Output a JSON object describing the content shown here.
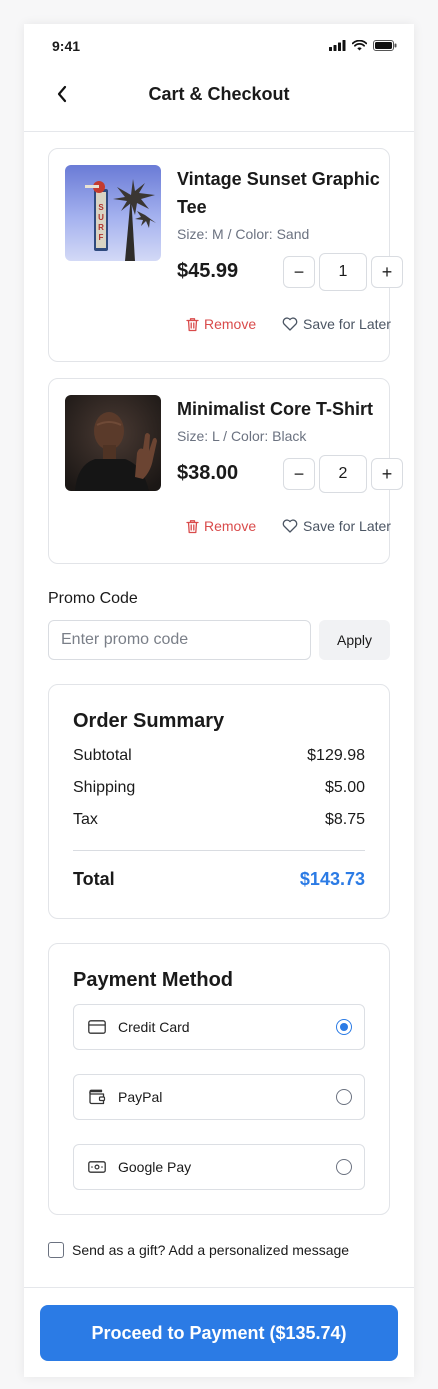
{
  "status_bar": {
    "time": "9:41",
    "icons": [
      "signal-icon",
      "wifi-icon",
      "battery-icon"
    ]
  },
  "header": {
    "title": "Cart & Checkout",
    "back_icon": "chevron-left-icon"
  },
  "cart": {
    "items": [
      {
        "name": "Vintage Sunset Graphic Tee",
        "meta": "Size: M / Color: Sand",
        "price": "$45.99",
        "quantity": "1",
        "remove_label": "Remove",
        "save_label": "Save for Later"
      },
      {
        "name": "Minimalist Core T-Shirt",
        "meta": "Size: L / Color: Black",
        "price": "$38.00",
        "quantity": "2",
        "remove_label": "Remove",
        "save_label": "Save for Later"
      }
    ],
    "minus_symbol": "−",
    "plus_symbol": "+"
  },
  "promo": {
    "label": "Promo Code",
    "placeholder": "Enter promo code",
    "value": "",
    "apply_label": "Apply"
  },
  "summary": {
    "title": "Order Summary",
    "rows": [
      {
        "label": "Subtotal",
        "value": "$129.98"
      },
      {
        "label": "Shipping",
        "value": "$5.00"
      },
      {
        "label": "Tax",
        "value": "$8.75"
      }
    ],
    "total_label": "Total",
    "total_value": "$143.73"
  },
  "payment": {
    "title": "Payment Method",
    "options": [
      {
        "label": "Credit Card",
        "icon": "credit-card-icon",
        "selected": true
      },
      {
        "label": "PayPal",
        "icon": "wallet-icon",
        "selected": false
      },
      {
        "label": "Google Pay",
        "icon": "cash-icon",
        "selected": false
      }
    ]
  },
  "gift": {
    "label": "Send as a gift? Add a personalized message",
    "checked": false
  },
  "cta": {
    "label": "Proceed to Payment ($135.74)"
  },
  "colors": {
    "accent": "#2b7be5",
    "danger": "#d94b4b",
    "border": "#e2e4e8"
  }
}
